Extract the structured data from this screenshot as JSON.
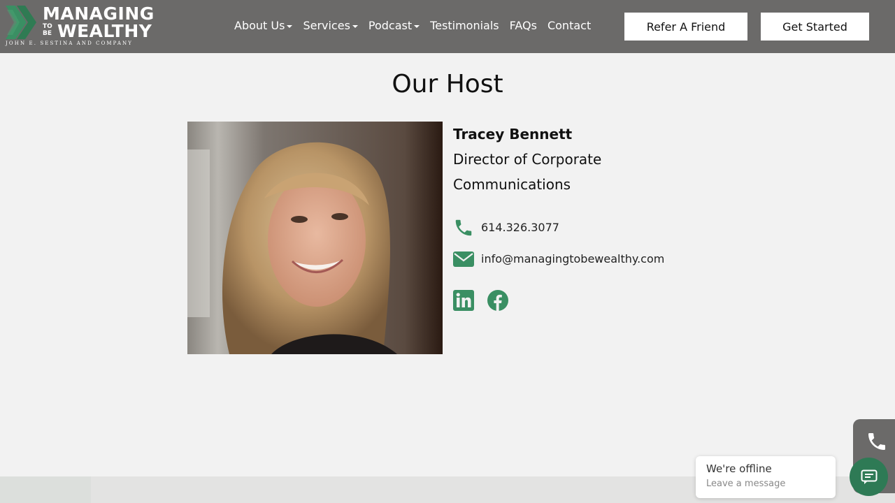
{
  "brand": {
    "line1": "MANAGING",
    "tobe": "TO BE",
    "line2": "WEALTHY",
    "subline": "JOHN E. SESTINA AND COMPANY",
    "accent": "#3a8f63",
    "header_bg": "#6b6a69"
  },
  "nav": {
    "items": [
      {
        "label": "About Us",
        "dropdown": true
      },
      {
        "label": "Services",
        "dropdown": true
      },
      {
        "label": "Podcast",
        "dropdown": true
      },
      {
        "label": "Testimonials",
        "dropdown": false
      },
      {
        "label": "FAQs",
        "dropdown": false
      },
      {
        "label": "Contact",
        "dropdown": false
      }
    ],
    "refer_label": "Refer A Friend",
    "start_label": "Get Started"
  },
  "section": {
    "title": "Our Host"
  },
  "host": {
    "name": "Tracey Bennett",
    "role": "Director of Corporate Communications",
    "phone": "614.326.3077",
    "email": "info@managingtobewealthy.com",
    "icons": [
      "phone-icon",
      "envelope-icon",
      "linkedin-icon",
      "facebook-icon"
    ]
  },
  "chat": {
    "title": "We're offline",
    "subtitle": "Leave a message"
  }
}
